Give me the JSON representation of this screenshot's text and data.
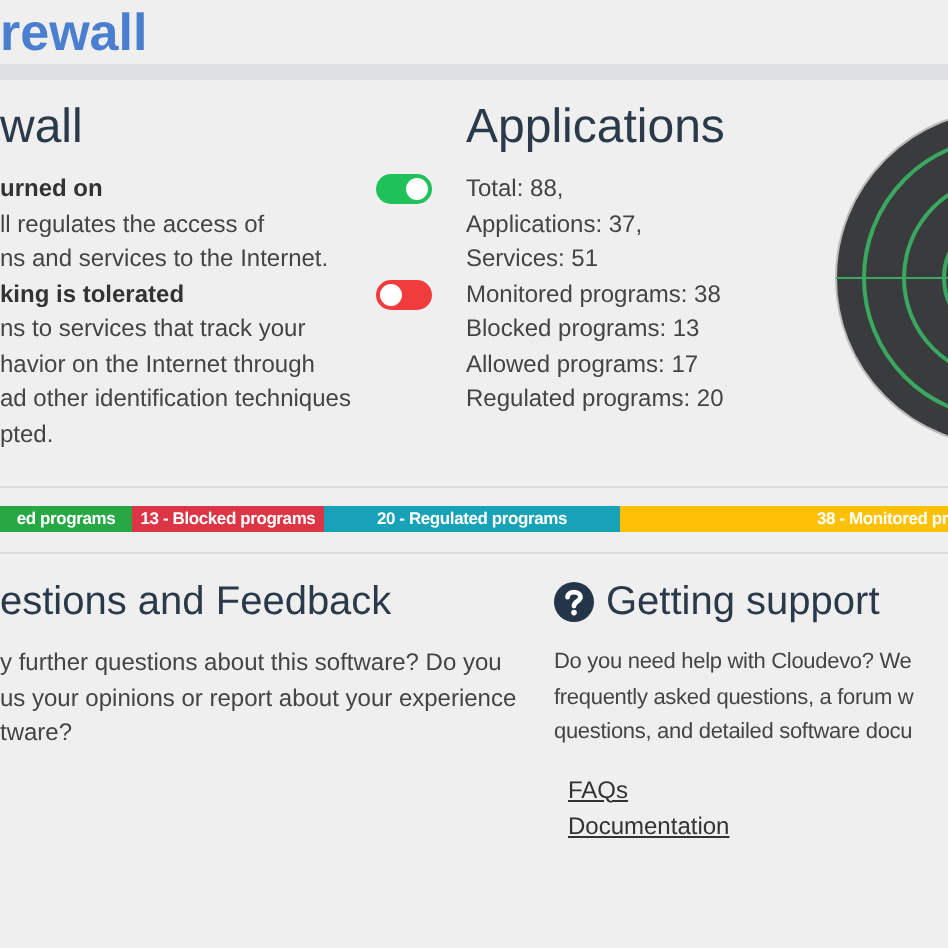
{
  "header": {
    "title": "rewall"
  },
  "firewall": {
    "heading": "wall",
    "statuses": [
      {
        "title": "urned on",
        "text": "ll regulates the access of\nns and services to the Internet.",
        "on": true
      },
      {
        "title": "king is tolerated",
        "text": "ns to services that track your\nhavior on the Internet through\nad other identification techniques\npted.",
        "on": false
      }
    ]
  },
  "applications": {
    "heading": "Applications",
    "stats": [
      "Total: 88,",
      "Applications: 37,",
      "Services: 51",
      "Monitored programs: 38",
      "Blocked programs: 13",
      "Allowed programs: 17",
      "Regulated programs: 20"
    ]
  },
  "distribution": [
    {
      "label": "ed programs",
      "color": "#28a745"
    },
    {
      "label": "13 - Blocked programs",
      "color": "#dc3545"
    },
    {
      "label": "20 - Regulated programs",
      "color": "#17a2b8"
    },
    {
      "label": "38 - Monitored pr",
      "color": "#ffc107"
    }
  ],
  "feedback": {
    "heading": "estions and Feedback",
    "text": "y further questions about this software? Do you\nus your opinions or report about your experience\ntware?"
  },
  "support": {
    "heading": "Getting support",
    "text": "Do you need help with Cloudevo? We\nfrequently asked questions, a forum w\nquestions, and detailed software docu",
    "links": [
      "FAQs",
      "Documentation"
    ]
  }
}
